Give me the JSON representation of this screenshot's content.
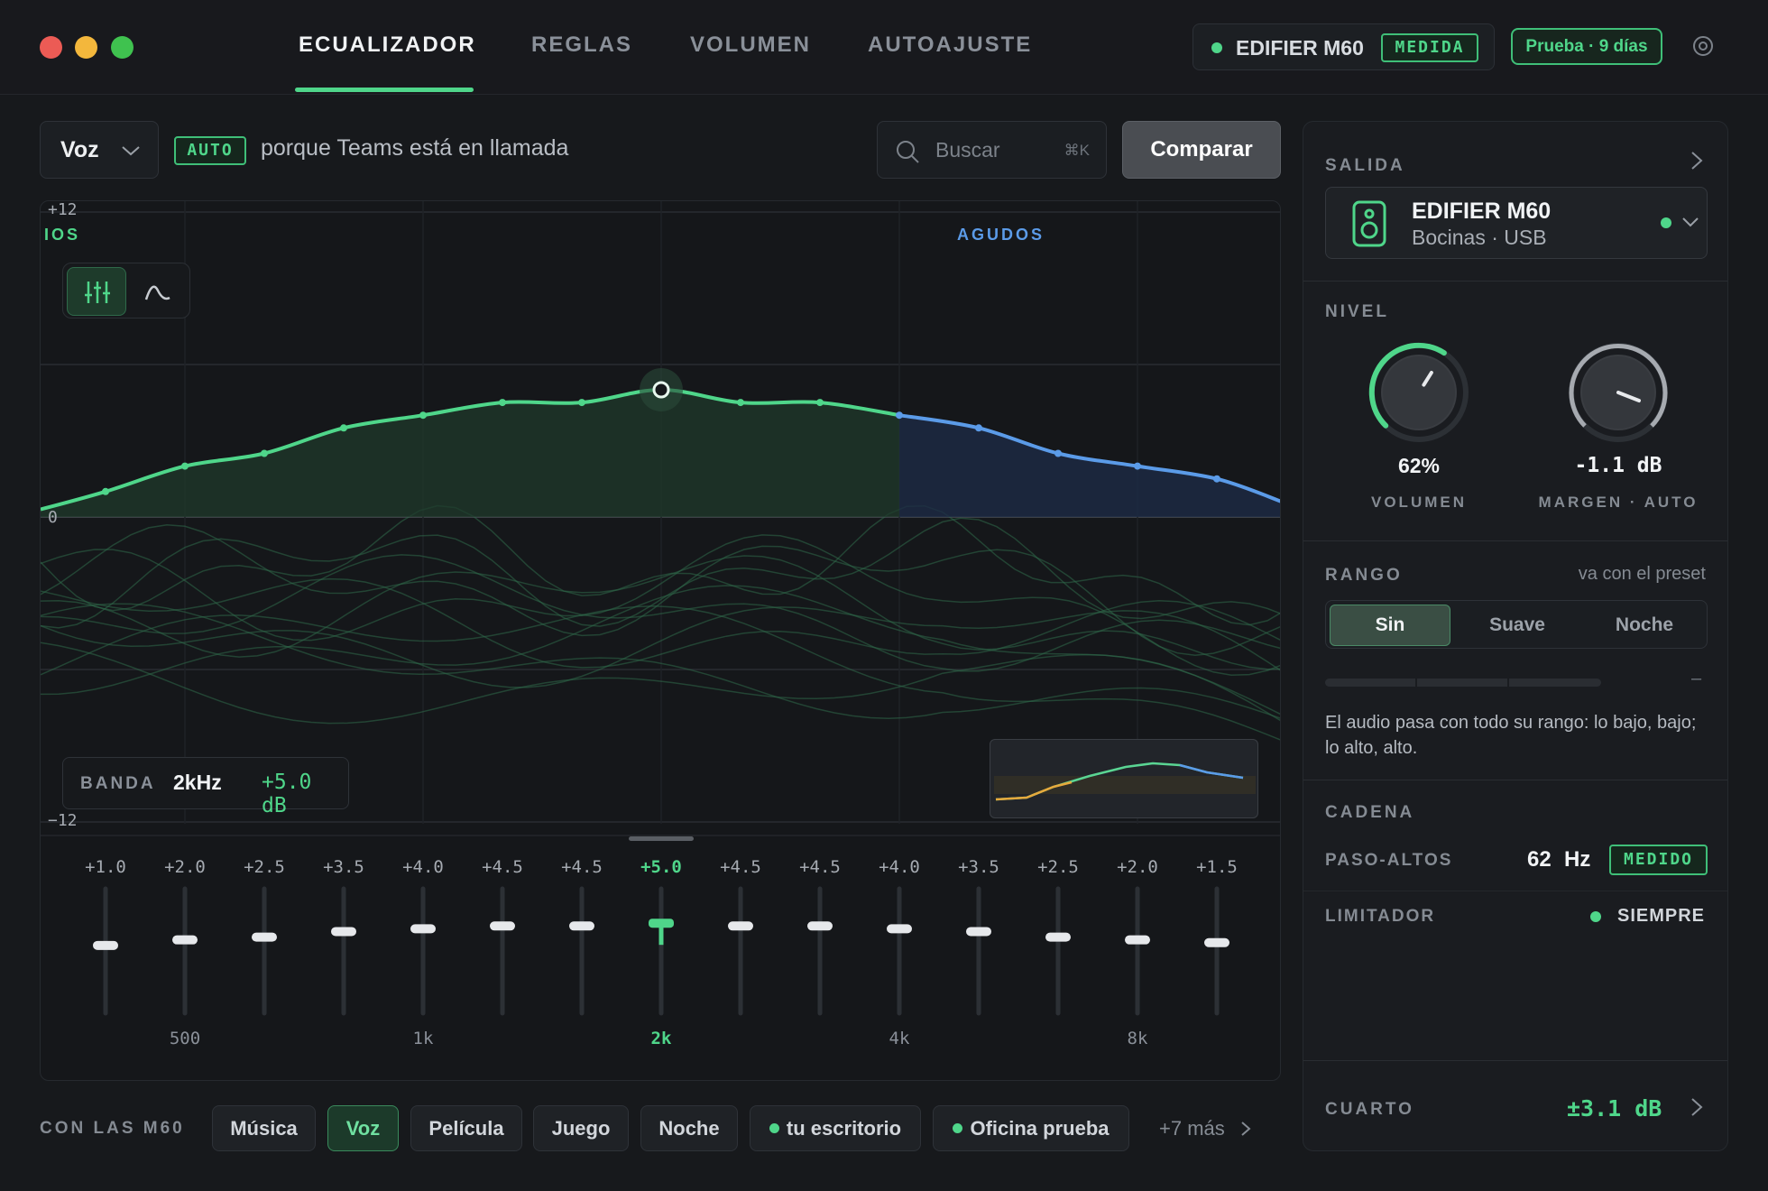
{
  "window": {
    "traffic_lights": [
      {
        "name": "close",
        "color": "#ec5b55"
      },
      {
        "name": "minimize",
        "color": "#f3b73c"
      },
      {
        "name": "maximize",
        "color": "#3fc24f"
      }
    ]
  },
  "nav": {
    "tabs": [
      {
        "label": "ECUALIZADOR",
        "active": true
      },
      {
        "label": "REGLAS",
        "active": false
      },
      {
        "label": "VOLUMEN",
        "active": false
      },
      {
        "label": "AUTOAJUSTE",
        "active": false
      }
    ]
  },
  "header": {
    "device_name": "EDIFIER M60",
    "device_badge": "MEDIDA",
    "trial": "Prueba · 9 días",
    "settings_icon": "gear-icon"
  },
  "toolbar": {
    "preset": "Voz",
    "auto_badge": "AUTO",
    "auto_reason": "porque Teams está en llamada",
    "search_placeholder": "Buscar",
    "search_shortcut": "⌘K",
    "compare_label": "Comparar"
  },
  "eq": {
    "y_max_label": "+12",
    "y_zero_label": "0",
    "y_min_label": "−12",
    "zone_left": "IOS",
    "zone_right": "AGUDOS",
    "bands": [
      {
        "gain": "+1.0",
        "value": 1.0,
        "freq_label": ""
      },
      {
        "gain": "+2.0",
        "value": 2.0,
        "freq_label": "500"
      },
      {
        "gain": "+2.5",
        "value": 2.5,
        "freq_label": ""
      },
      {
        "gain": "+3.5",
        "value": 3.5,
        "freq_label": ""
      },
      {
        "gain": "+4.0",
        "value": 4.0,
        "freq_label": "1k"
      },
      {
        "gain": "+4.5",
        "value": 4.5,
        "freq_label": ""
      },
      {
        "gain": "+4.5",
        "value": 4.5,
        "freq_label": ""
      },
      {
        "gain": "+5.0",
        "value": 5.0,
        "freq_label": "2k",
        "selected": true
      },
      {
        "gain": "+4.5",
        "value": 4.5,
        "freq_label": ""
      },
      {
        "gain": "+4.5",
        "value": 4.5,
        "freq_label": ""
      },
      {
        "gain": "+4.0",
        "value": 4.0,
        "freq_label": "4k"
      },
      {
        "gain": "+3.5",
        "value": 3.5,
        "freq_label": ""
      },
      {
        "gain": "+2.5",
        "value": 2.5,
        "freq_label": ""
      },
      {
        "gain": "+2.0",
        "value": 2.0,
        "freq_label": "8k"
      },
      {
        "gain": "+1.5",
        "value": 1.5,
        "freq_label": ""
      }
    ],
    "band_readout": {
      "label": "BANDA",
      "freq": "2kHz",
      "gain": "+5.0 dB"
    },
    "accent_green": "#4fd68a",
    "accent_blue": "#5b9be8"
  },
  "presets": {
    "title": "CON LAS M60",
    "items": [
      {
        "label": "Música",
        "active": false,
        "dot": false
      },
      {
        "label": "Voz",
        "active": true,
        "dot": false
      },
      {
        "label": "Película",
        "active": false,
        "dot": false
      },
      {
        "label": "Juego",
        "active": false,
        "dot": false
      },
      {
        "label": "Noche",
        "active": false,
        "dot": false
      },
      {
        "label": "tu escritorio",
        "active": false,
        "dot": true
      },
      {
        "label": "Oficina prueba",
        "active": false,
        "dot": true
      }
    ],
    "more": "+7 más"
  },
  "output": {
    "title": "SALIDA",
    "device": "EDIFIER M60",
    "subtitle": "Bocinas · USB"
  },
  "level": {
    "title": "NIVEL",
    "volume_value": "62%",
    "volume_fraction": 0.62,
    "volume_label": "VOLUMEN",
    "margin_value": "-1.1 dB",
    "margin_label": "MARGEN · AUTO"
  },
  "range": {
    "title": "RANGO",
    "hint": "va con el preset",
    "options": [
      {
        "label": "Sin",
        "active": true
      },
      {
        "label": "Suave",
        "active": false
      },
      {
        "label": "Noche",
        "active": false
      }
    ],
    "bar_end": "–",
    "description": "El audio pasa con todo su rango: lo bajo, bajo; lo alto, alto."
  },
  "chain": {
    "title": "CADENA",
    "highpass_label": "PASO-ALTOS",
    "highpass_value": "62",
    "highpass_unit": "Hz",
    "highpass_badge": "MEDIDO",
    "limiter_label": "LIMITADOR",
    "limiter_value": "SIEMPRE"
  },
  "room": {
    "label": "CUARTO",
    "value": "±3.1 dB"
  }
}
